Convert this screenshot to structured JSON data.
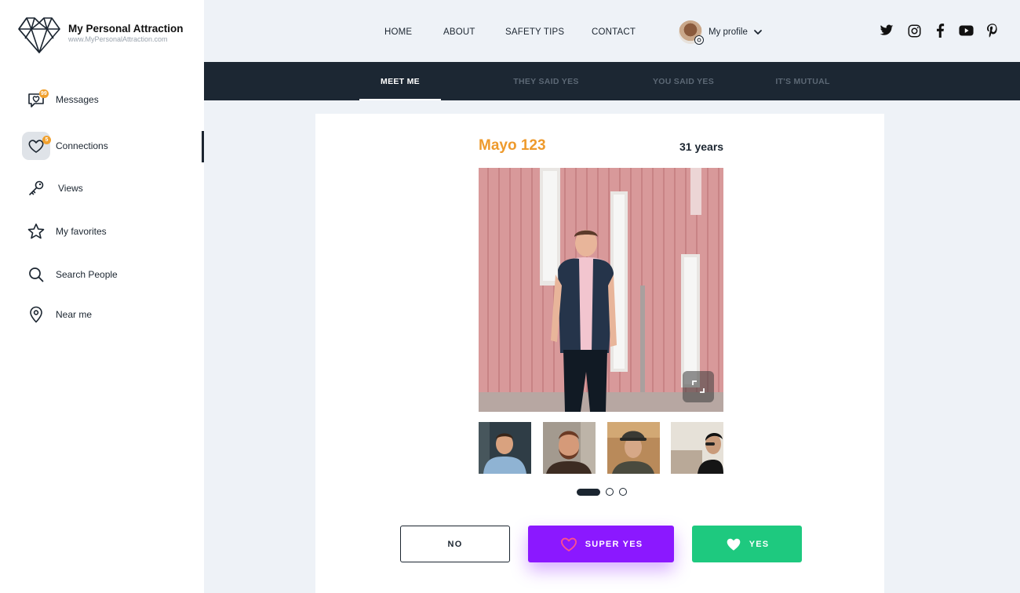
{
  "brand": {
    "title": "My Personal Attraction",
    "url": "www.MyPersonalAttraction.com"
  },
  "sidebar": {
    "items": [
      {
        "label": "Messages",
        "icon": "message-heart-icon",
        "badge": "99"
      },
      {
        "label": "Connections",
        "icon": "heart-icon",
        "badge": "5",
        "active": true
      },
      {
        "label": "Views",
        "icon": "key-icon"
      },
      {
        "label": "My favorites",
        "icon": "star-icon"
      },
      {
        "label": "Search People",
        "icon": "search-icon"
      },
      {
        "label": "Near me",
        "icon": "location-pin-icon"
      }
    ]
  },
  "topnav": {
    "links": [
      "HOME",
      "ABOUT",
      "SAFETY TIPS",
      "CONTACT"
    ],
    "profile_label": "My profile",
    "social": [
      "twitter-icon",
      "instagram-icon",
      "facebook-icon",
      "youtube-icon",
      "pinterest-icon"
    ]
  },
  "tabs": [
    {
      "label": "MEET ME",
      "active": true
    },
    {
      "label": "THEY SAID YES",
      "active": false
    },
    {
      "label": "YOU SAID YES",
      "active": false
    },
    {
      "label": "IT'S MUTUAL",
      "active": false
    }
  ],
  "profile_card": {
    "name": "Mayo 123",
    "age": "31 years",
    "photo_count": 4,
    "page_dots": 3,
    "active_dot": 0
  },
  "actions": {
    "no": "NO",
    "super_yes": "SUPER YES",
    "yes": "YES"
  },
  "colors": {
    "accent_orange": "#ee9a2c",
    "super_purple": "#8b18ff",
    "yes_green": "#1ec97f",
    "dark_navy": "#1c2733",
    "badge": "#f0a02e"
  }
}
